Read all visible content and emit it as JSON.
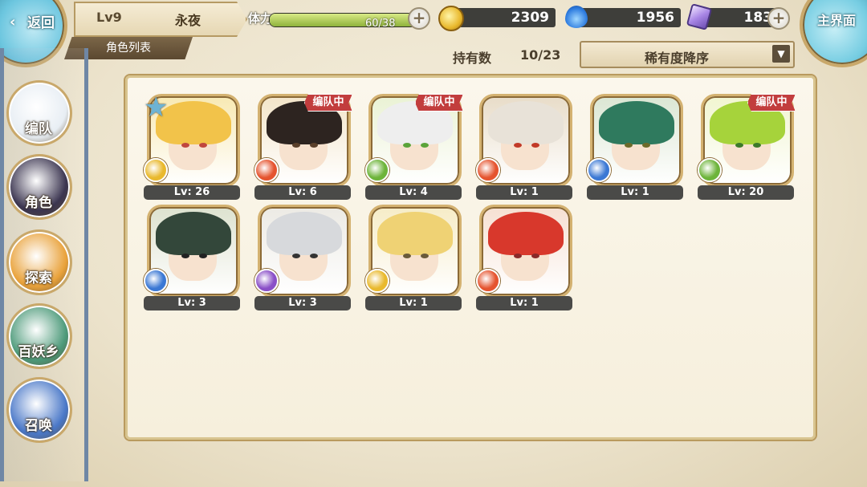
{
  "header": {
    "back_label": "返回",
    "player_level": "Lv9",
    "player_name": "永夜",
    "stamina_label": "体力",
    "stamina_value": "60/38",
    "stamina_fill_fraction": 1.0,
    "gold": "2309",
    "souls": "1956",
    "gems": "183",
    "home_label": "主界面"
  },
  "toolbar": {
    "section_title": "角色列表",
    "owned_label": "持有数",
    "owned_count": "10/23",
    "sort_label": "稀有度降序"
  },
  "sidebar": {
    "items": [
      {
        "label": "编队",
        "icon": "team-icon",
        "color": "#e8eef4"
      },
      {
        "label": "角色",
        "icon": "character-icon",
        "color": "#3b3550"
      },
      {
        "label": "探索",
        "icon": "explore-icon",
        "color": "#e9a23b"
      },
      {
        "label": "百妖乡",
        "icon": "village-icon",
        "color": "#4d9a7a"
      },
      {
        "label": "召唤",
        "icon": "summon-icon",
        "color": "#4a78c8"
      }
    ]
  },
  "characters": [
    {
      "level": "Lv: 26",
      "in_team": false,
      "starred": true,
      "element": "light",
      "hair": "#f2c34a",
      "eyes": "#c0463e",
      "bg": "#f8e9b3",
      "badge": "#e9b92e"
    },
    {
      "level": "Lv: 6",
      "in_team": true,
      "starred": false,
      "element": "fire",
      "hair": "#2d2420",
      "eyes": "#5a3f2a",
      "bg": "#f3e5c9",
      "badge": "#e5542f"
    },
    {
      "level": "Lv: 4",
      "in_team": true,
      "starred": false,
      "element": "wind",
      "hair": "#eeeeee",
      "eyes": "#5aa33a",
      "bg": "#eaf2d4",
      "badge": "#6db43a"
    },
    {
      "level": "Lv: 1",
      "in_team": false,
      "starred": false,
      "element": "fire",
      "hair": "#e8e2d8",
      "eyes": "#c23a28",
      "bg": "#e8dcc8",
      "badge": "#e5542f"
    },
    {
      "level": "Lv: 1",
      "in_team": false,
      "starred": false,
      "element": "water",
      "hair": "#2f7a5e",
      "eyes": "#6d6a2a",
      "bg": "#dbe6d3",
      "badge": "#3b78d4"
    },
    {
      "level": "Lv: 20",
      "in_team": true,
      "starred": false,
      "element": "wind",
      "hair": "#a6d33b",
      "eyes": "#3c7a2a",
      "bg": "#f1f5d0",
      "badge": "#6db43a"
    },
    {
      "level": "Lv: 3",
      "in_team": false,
      "starred": false,
      "element": "water",
      "hair": "#33473a",
      "eyes": "#222222",
      "bg": "#dde2cf",
      "badge": "#3b78d4"
    },
    {
      "level": "Lv: 3",
      "in_team": false,
      "starred": false,
      "element": "dark",
      "hair": "#d7d9dc",
      "eyes": "#333333",
      "bg": "#eceae4",
      "badge": "#8a4fc7"
    },
    {
      "level": "Lv: 1",
      "in_team": false,
      "starred": false,
      "element": "light",
      "hair": "#efd274",
      "eyes": "#6a5a3a",
      "bg": "#f6ecc7",
      "badge": "#e9b92e"
    },
    {
      "level": "Lv: 1",
      "in_team": false,
      "starred": false,
      "element": "fire",
      "hair": "#d8382c",
      "eyes": "#8a2a2a",
      "bg": "#f6e0d2",
      "badge": "#e5542f"
    }
  ],
  "team_tag_label": "编队中"
}
